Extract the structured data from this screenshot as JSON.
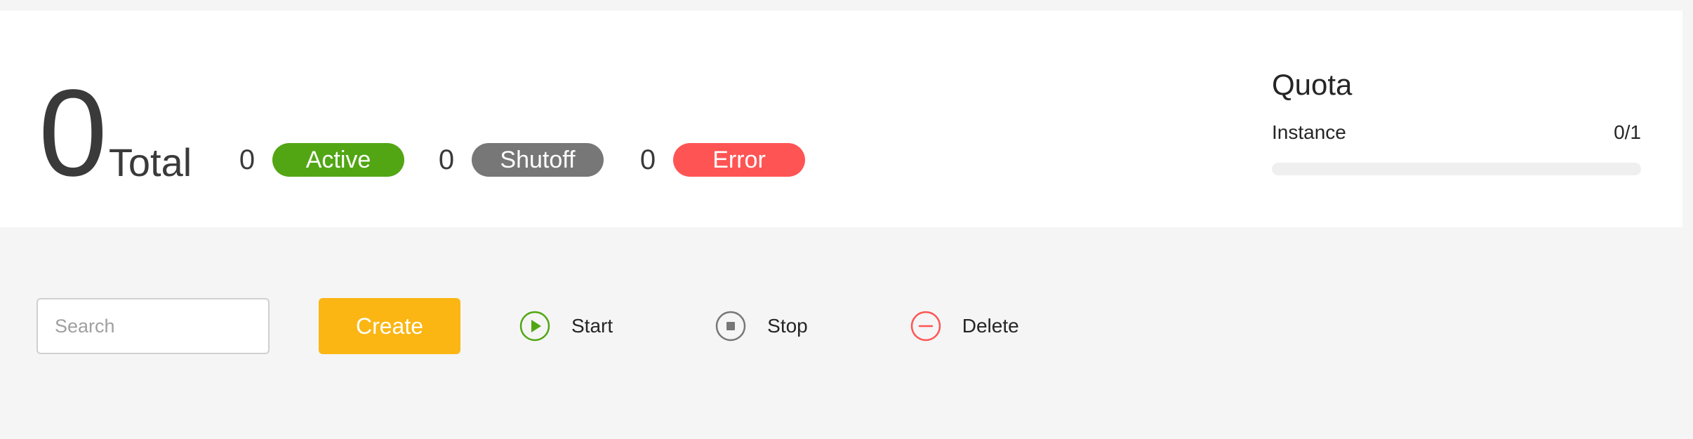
{
  "summary": {
    "total_count": "0",
    "total_label": "Total",
    "statuses": [
      {
        "count": "0",
        "label": "Active",
        "color": "#52a614"
      },
      {
        "count": "0",
        "label": "Shutoff",
        "color": "#777777"
      },
      {
        "count": "0",
        "label": "Error",
        "color": "#ff5454"
      }
    ]
  },
  "quota": {
    "title": "Quota",
    "items": [
      {
        "label": "Instance",
        "usage": "0/1",
        "used_fraction": 0
      }
    ]
  },
  "toolbar": {
    "search_placeholder": "Search",
    "create_label": "Create",
    "start_label": "Start",
    "stop_label": "Stop",
    "delete_label": "Delete"
  },
  "colors": {
    "create": "#fbb614",
    "start_icon": "#52a614",
    "stop_icon": "#777777",
    "delete_icon": "#ff5454"
  },
  "icons": {
    "start": "play-circle-icon",
    "stop": "stop-circle-icon",
    "delete": "minus-circle-icon"
  }
}
